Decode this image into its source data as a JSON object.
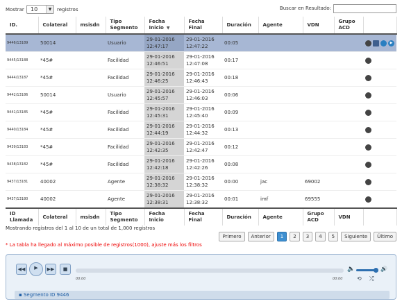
{
  "controls": {
    "show_label": "Mostrar",
    "length_value": "10",
    "records_label": "registros",
    "search_label": "Buscar en Resultado:",
    "search_value": ""
  },
  "table": {
    "header": [
      "ID.",
      "Colateral",
      "msisdn",
      "Tipo Segmento",
      "Fecha Inicio",
      "Fecha Final",
      "Duración",
      "Agente",
      "VDN",
      "Grupo ACD",
      ""
    ],
    "footer": [
      "ID Llamada",
      "Colateral",
      "msisdn",
      "Tipo Segmento",
      "Fecha Inicio",
      "Fecha Final",
      "Duración",
      "Agente",
      "Grupo ACD",
      "VDN",
      ""
    ],
    "rows": [
      {
        "id": "9446/13189",
        "colateral": "50014",
        "msisdn": "",
        "tipo": "Usuario",
        "inicio": "29-01-2016 12:47:17",
        "final": "29-01-2016 12:47:22",
        "duracion": "00:05",
        "agente": "",
        "vdn": "",
        "grupo": "",
        "selected": true
      },
      {
        "id": "9445/13188",
        "colateral": "*45#",
        "msisdn": "",
        "tipo": "Facilidad",
        "inicio": "29-01-2016 12:46:51",
        "final": "29-01-2016 12:47:08",
        "duracion": "00:17",
        "agente": "",
        "vdn": "",
        "grupo": ""
      },
      {
        "id": "9444/13187",
        "colateral": "*45#",
        "msisdn": "",
        "tipo": "Facilidad",
        "inicio": "29-01-2016 12:46:25",
        "final": "29-01-2016 12:46:43",
        "duracion": "00:18",
        "agente": "",
        "vdn": "",
        "grupo": ""
      },
      {
        "id": "9442/13186",
        "colateral": "50014",
        "msisdn": "",
        "tipo": "Usuario",
        "inicio": "29-01-2016 12:45:57",
        "final": "29-01-2016 12:46:03",
        "duracion": "00:06",
        "agente": "",
        "vdn": "",
        "grupo": ""
      },
      {
        "id": "9441/13185",
        "colateral": "*45#",
        "msisdn": "",
        "tipo": "Facilidad",
        "inicio": "29-01-2016 12:45:31",
        "final": "29-01-2016 12:45:40",
        "duracion": "00:09",
        "agente": "",
        "vdn": "",
        "grupo": ""
      },
      {
        "id": "9440/13184",
        "colateral": "*45#",
        "msisdn": "",
        "tipo": "Facilidad",
        "inicio": "29-01-2016 12:44:19",
        "final": "29-01-2016 12:44:32",
        "duracion": "00:13",
        "agente": "",
        "vdn": "",
        "grupo": ""
      },
      {
        "id": "9439/13183",
        "colateral": "*45#",
        "msisdn": "",
        "tipo": "Facilidad",
        "inicio": "29-01-2016 12:42:35",
        "final": "29-01-2016 12:42:47",
        "duracion": "00:12",
        "agente": "",
        "vdn": "",
        "grupo": ""
      },
      {
        "id": "9438/13182",
        "colateral": "*45#",
        "msisdn": "",
        "tipo": "Facilidad",
        "inicio": "29-01-2016 12:42:18",
        "final": "29-01-2016 12:42:26",
        "duracion": "00:08",
        "agente": "",
        "vdn": "",
        "grupo": ""
      },
      {
        "id": "9437/13181",
        "colateral": "40002",
        "msisdn": "",
        "tipo": "Agente",
        "inicio": "29-01-2016 12:38:32",
        "final": "29-01-2016 12:38:32",
        "duracion": "00:00",
        "agente": "jac",
        "vdn": "69002",
        "grupo": ""
      },
      {
        "id": "9437/13180",
        "colateral": "40002",
        "msisdn": "",
        "tipo": "Agente",
        "inicio": "29-01-2016 12:38:31",
        "final": "29-01-2016 12:38:32",
        "duracion": "00:01",
        "agente": "imf",
        "vdn": "69555",
        "grupo": ""
      }
    ]
  },
  "info": "Mostrando registros del 1 al 10 de un total de 1,000 registros",
  "pagination": {
    "first": "Primero",
    "prev": "Anterior",
    "pages": [
      "1",
      "2",
      "3",
      "4",
      "5"
    ],
    "current": "1",
    "next": "Siguiente",
    "last": "Último"
  },
  "warning": "* La tabla ha llegado al máximo posible de registros(1000), ajuste más los filtros",
  "player": {
    "time_current": "00:00",
    "time_total": "00:00",
    "segment": "Segmento ID 9446"
  }
}
